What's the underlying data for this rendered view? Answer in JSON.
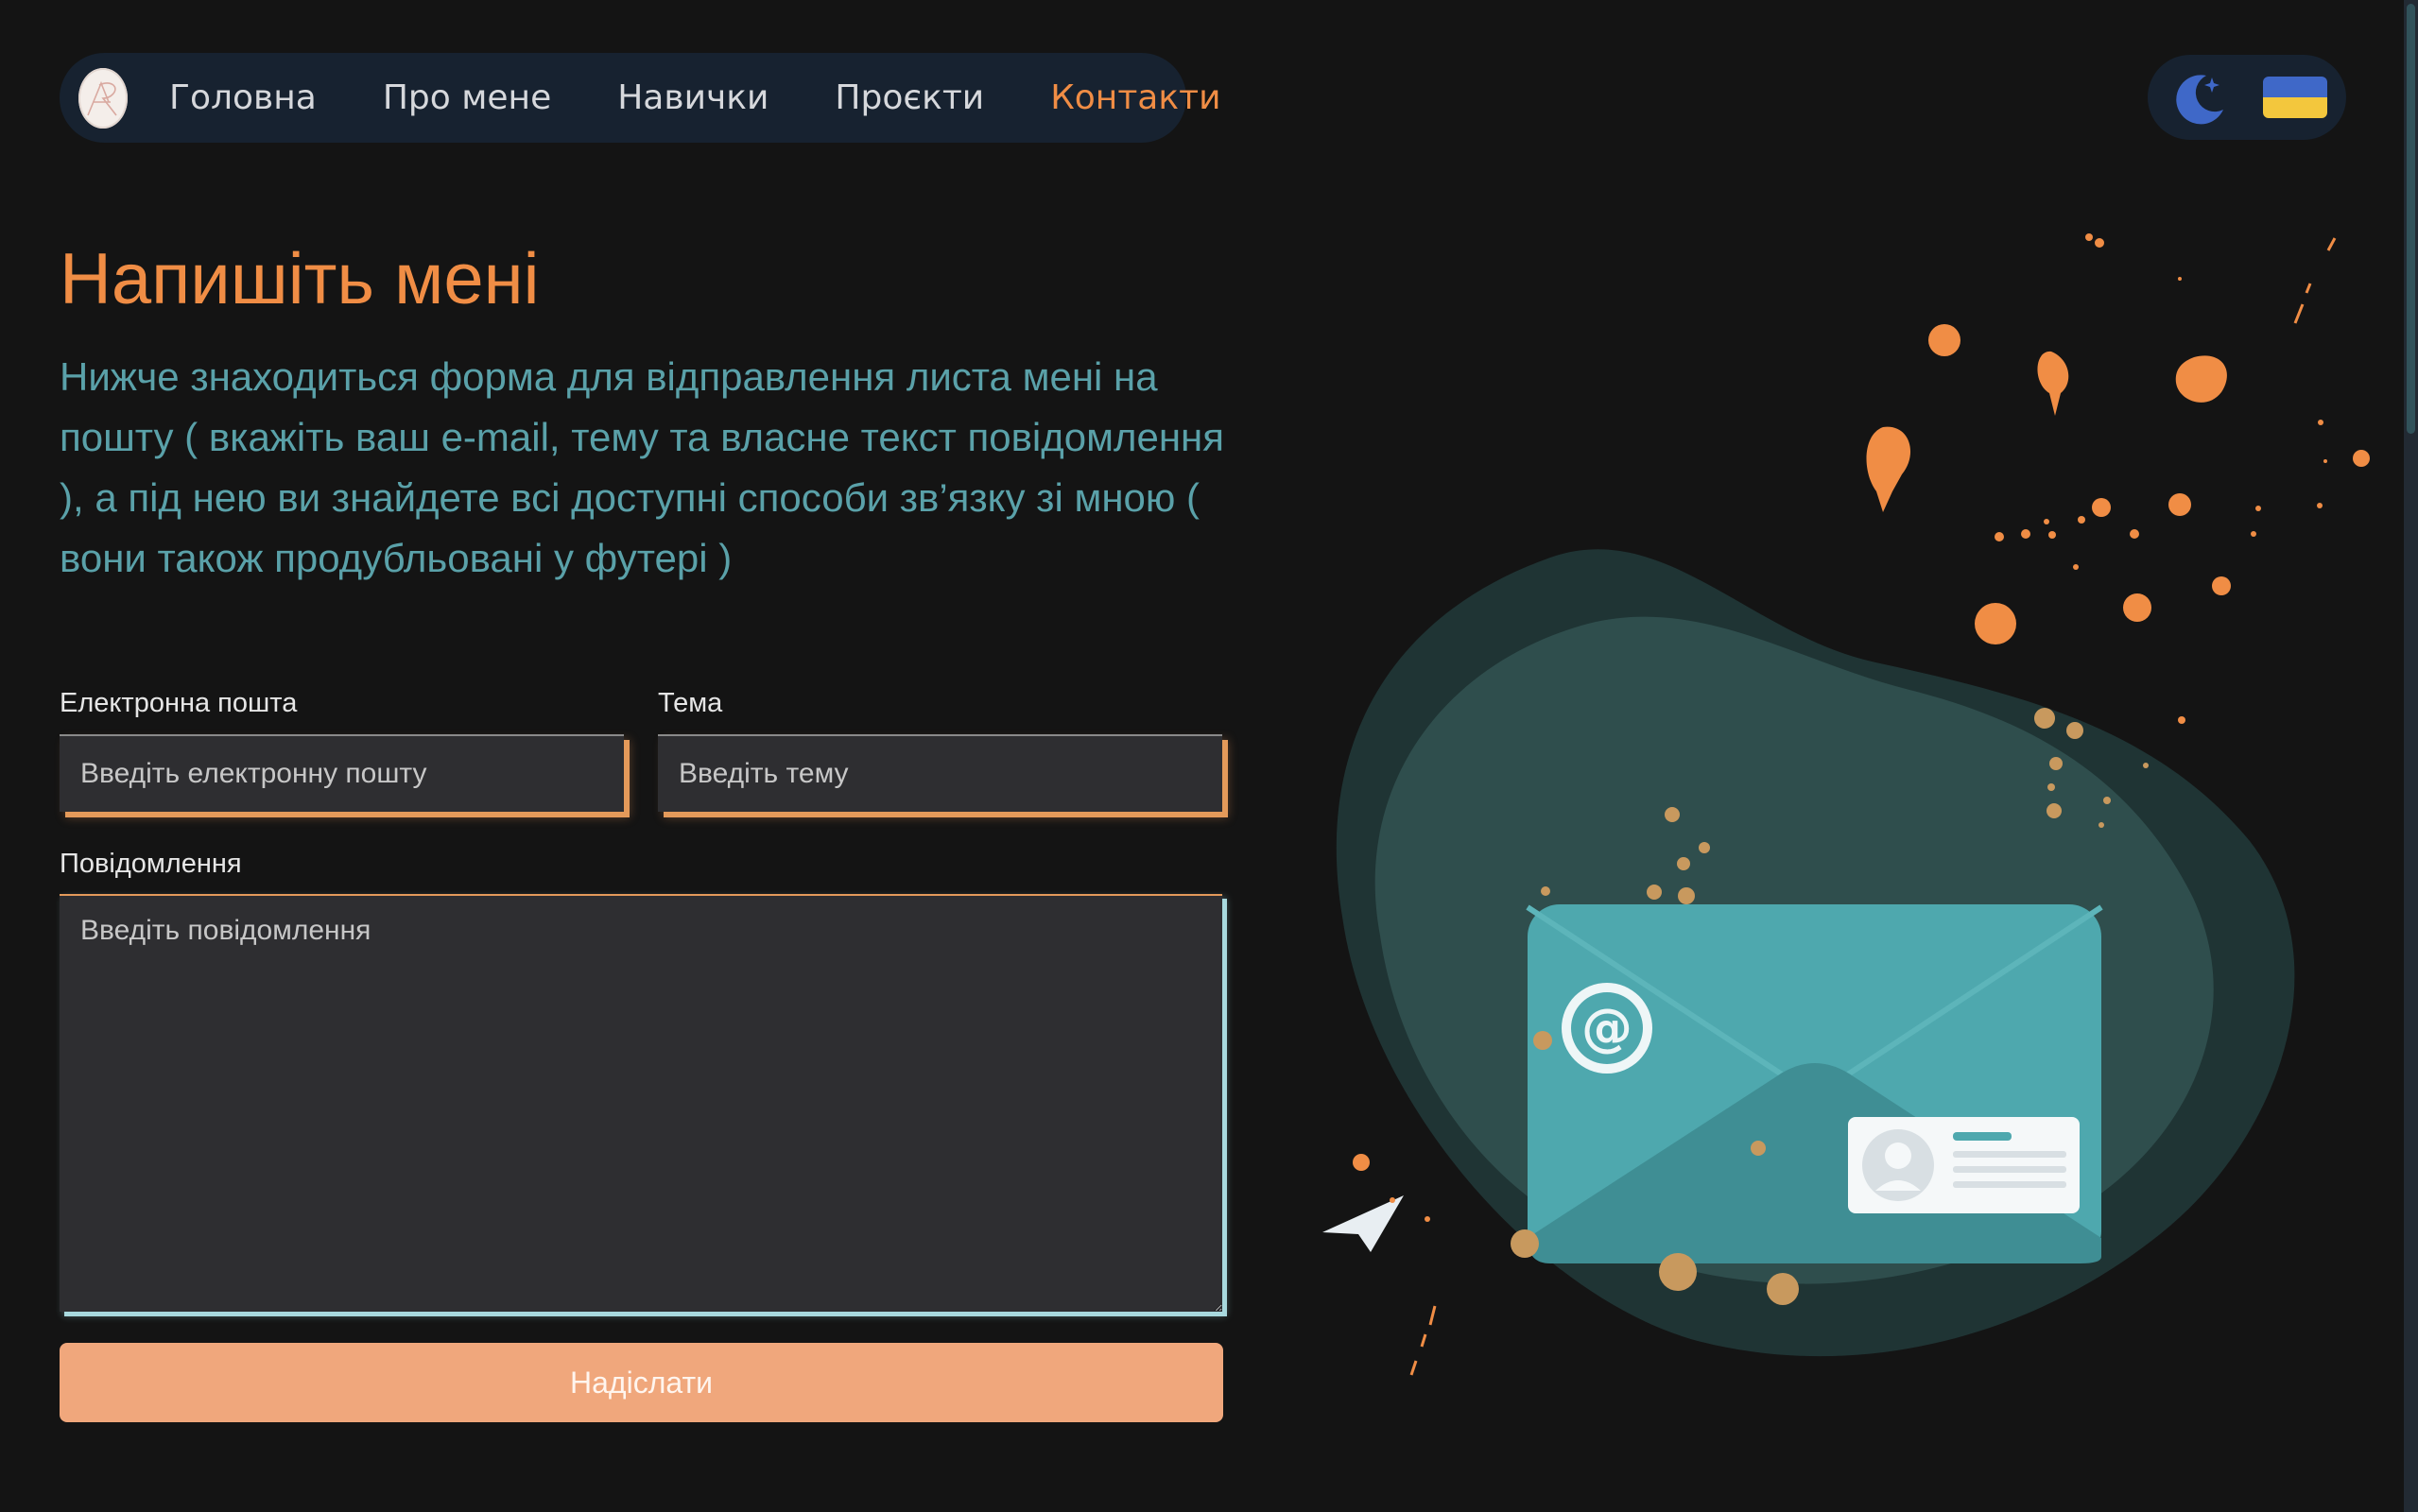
{
  "nav": {
    "logo_alt": "logo",
    "links": [
      {
        "label": "Головна"
      },
      {
        "label": "Про мене"
      },
      {
        "label": "Навички"
      },
      {
        "label": "Проєкти"
      },
      {
        "label": "Контакти",
        "active": true
      }
    ]
  },
  "settings": {
    "theme_icon": "moon-icon",
    "language_icon": "ukraine-flag-icon"
  },
  "contact": {
    "title": "Напишіть мені",
    "intro": "Нижче знаходиться форма для відправлення листа мені на пошту ( вкажіть ваш e-mail, тему та власне текст повідомлення ), а під нею ви знайдете всі доступні способи зв’язку зі мною ( вони також продубльовані у футері )",
    "email_label": "Електронна пошта",
    "email_placeholder": "Введіть електронну пошту",
    "subject_label": "Тема",
    "subject_placeholder": "Введіть тему",
    "message_label": "Повідомлення",
    "message_placeholder": "Введіть повідомлення",
    "submit_label": "Надіслати"
  },
  "colors": {
    "accent": "#f08d45",
    "teal_text": "#5aa1a9",
    "nav_bg": "#172230",
    "page_bg": "#141414",
    "button": "#f0a77c"
  }
}
